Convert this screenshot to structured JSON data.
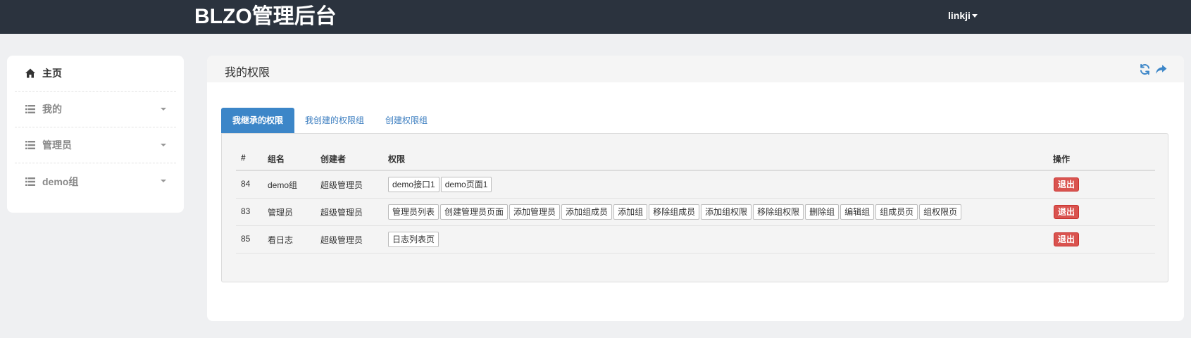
{
  "header": {
    "brand": "BLZO管理后台",
    "user": "linkji"
  },
  "sidebar": {
    "items": [
      {
        "label": "主页",
        "icon": "home-icon"
      },
      {
        "label": "我的",
        "icon": "list-icon"
      },
      {
        "label": "管理员",
        "icon": "list-icon"
      },
      {
        "label": "demo组",
        "icon": "list-icon"
      }
    ]
  },
  "panel": {
    "title": "我的权限",
    "icons": [
      "refresh-icon",
      "share-icon"
    ]
  },
  "tabs": [
    "我继承的权限",
    "我创建的权限组",
    "创建权限组"
  ],
  "table": {
    "columns": [
      "#",
      "组名",
      "创建者",
      "权限",
      "操作"
    ],
    "rows": [
      {
        "id": "84",
        "name": "demo组",
        "creator": "超级管理员",
        "perms": [
          "demo接口1",
          "demo页面1"
        ],
        "action": "退出"
      },
      {
        "id": "83",
        "name": "管理员",
        "creator": "超级管理员",
        "perms": [
          "管理员列表",
          "创建管理员页面",
          "添加管理员",
          "添加组成员",
          "添加组",
          "移除组成员",
          "添加组权限",
          "移除组权限",
          "删除组",
          "编辑组",
          "组成员页",
          "组权限页"
        ],
        "action": "退出"
      },
      {
        "id": "85",
        "name": "看日志",
        "creator": "超级管理员",
        "perms": [
          "日志列表页"
        ],
        "action": "退出"
      }
    ]
  },
  "colors": {
    "topbar": "#2b333e",
    "accent": "#3c86c8",
    "danger": "#d9534f",
    "background": "#eff0f2"
  }
}
